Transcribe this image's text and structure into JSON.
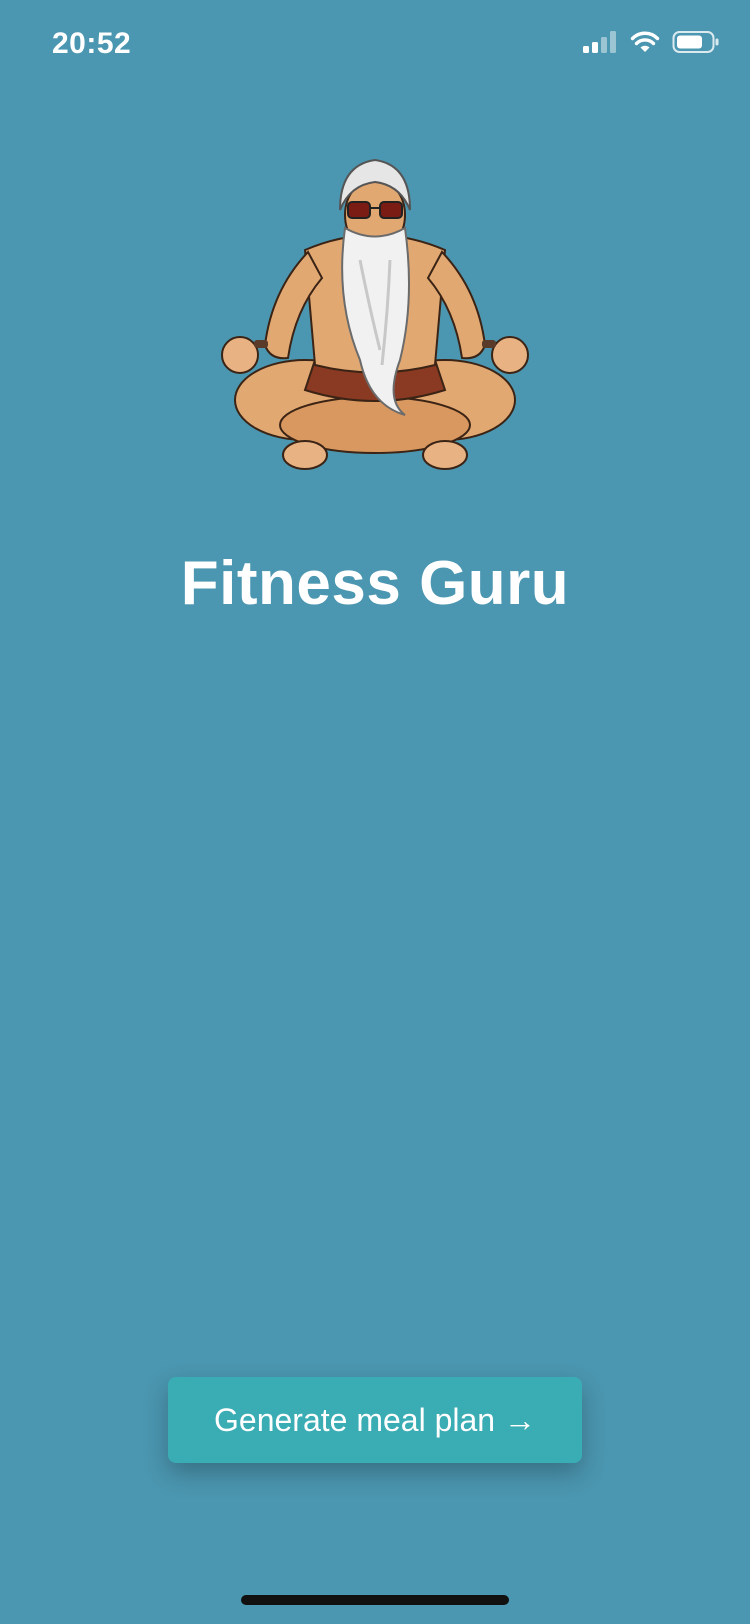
{
  "status_bar": {
    "time": "20:52",
    "icons": [
      "cellular-signal-icon",
      "wifi-icon",
      "battery-icon"
    ]
  },
  "app": {
    "title": "Fitness Guru",
    "illustration": "meditating-guru-illustration"
  },
  "cta": {
    "label": "Generate meal plan →"
  },
  "colors": {
    "background": "#4b96b0",
    "button": "#3aacb4",
    "text": "#ffffff"
  }
}
